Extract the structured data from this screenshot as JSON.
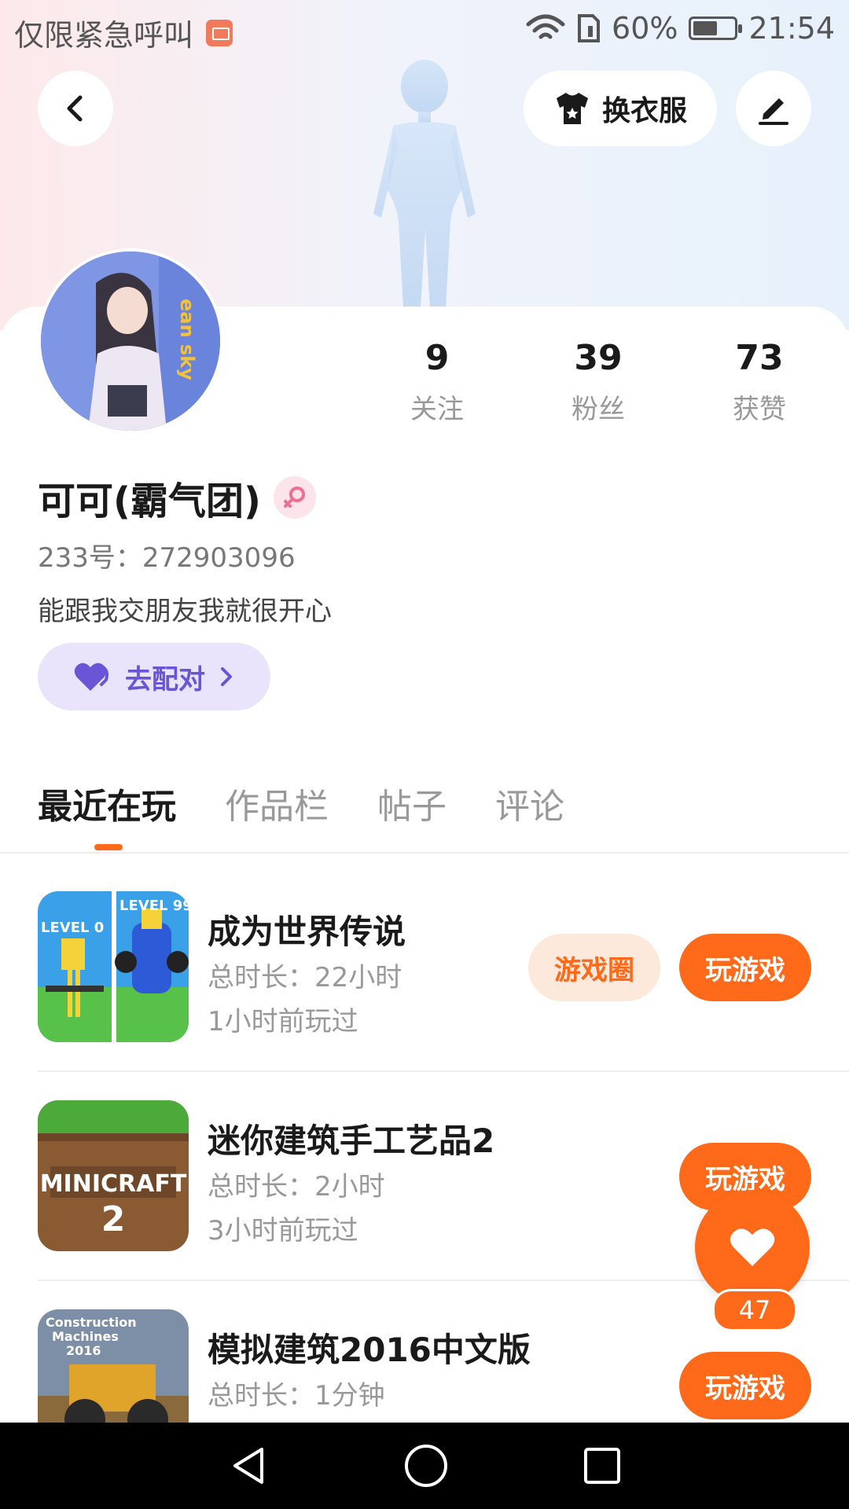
{
  "status_bar": {
    "carrier_text": "仅限紧急呼叫",
    "battery_percent": "60%",
    "battery_level": 0.6,
    "time": "21:54"
  },
  "header": {
    "outfit_button_label": "换衣服"
  },
  "profile": {
    "stats": [
      {
        "value": "9",
        "label": "关注"
      },
      {
        "value": "39",
        "label": "粉丝"
      },
      {
        "value": "73",
        "label": "获赞"
      }
    ],
    "nickname": "可可(霸气团)",
    "uid": "233号：272903096",
    "bio": "能跟我交朋友我就很开心",
    "match_button_label": "去配对"
  },
  "tabs": [
    {
      "label": "最近在玩",
      "active": true
    },
    {
      "label": "作品栏",
      "active": false
    },
    {
      "label": "帖子",
      "active": false
    },
    {
      "label": "评论",
      "active": false
    }
  ],
  "games": [
    {
      "name": "成为世界传说",
      "duration": "总时长：22小时",
      "last_played": "1小时前玩过",
      "circle_button": "游戏圈",
      "play_button": "玩游戏"
    },
    {
      "name": "迷你建筑手工艺品2",
      "duration": "总时长：2小时",
      "last_played": "3小时前玩过",
      "play_button": "玩游戏"
    },
    {
      "name": "模拟建筑2016中文版",
      "duration": "总时长：1分钟",
      "play_button": "玩游戏"
    }
  ],
  "like": {
    "count": "47"
  },
  "icons": {
    "back": "back-arrow-icon",
    "outfit": "tshirt-icon",
    "edit": "pencil-icon",
    "gender": "female-icon",
    "match": "heart-icon",
    "like": "heart-icon"
  },
  "colors": {
    "accent": "#ff6a1a",
    "match_bg": "#e9e4fb",
    "match_text": "#6a55d6"
  }
}
